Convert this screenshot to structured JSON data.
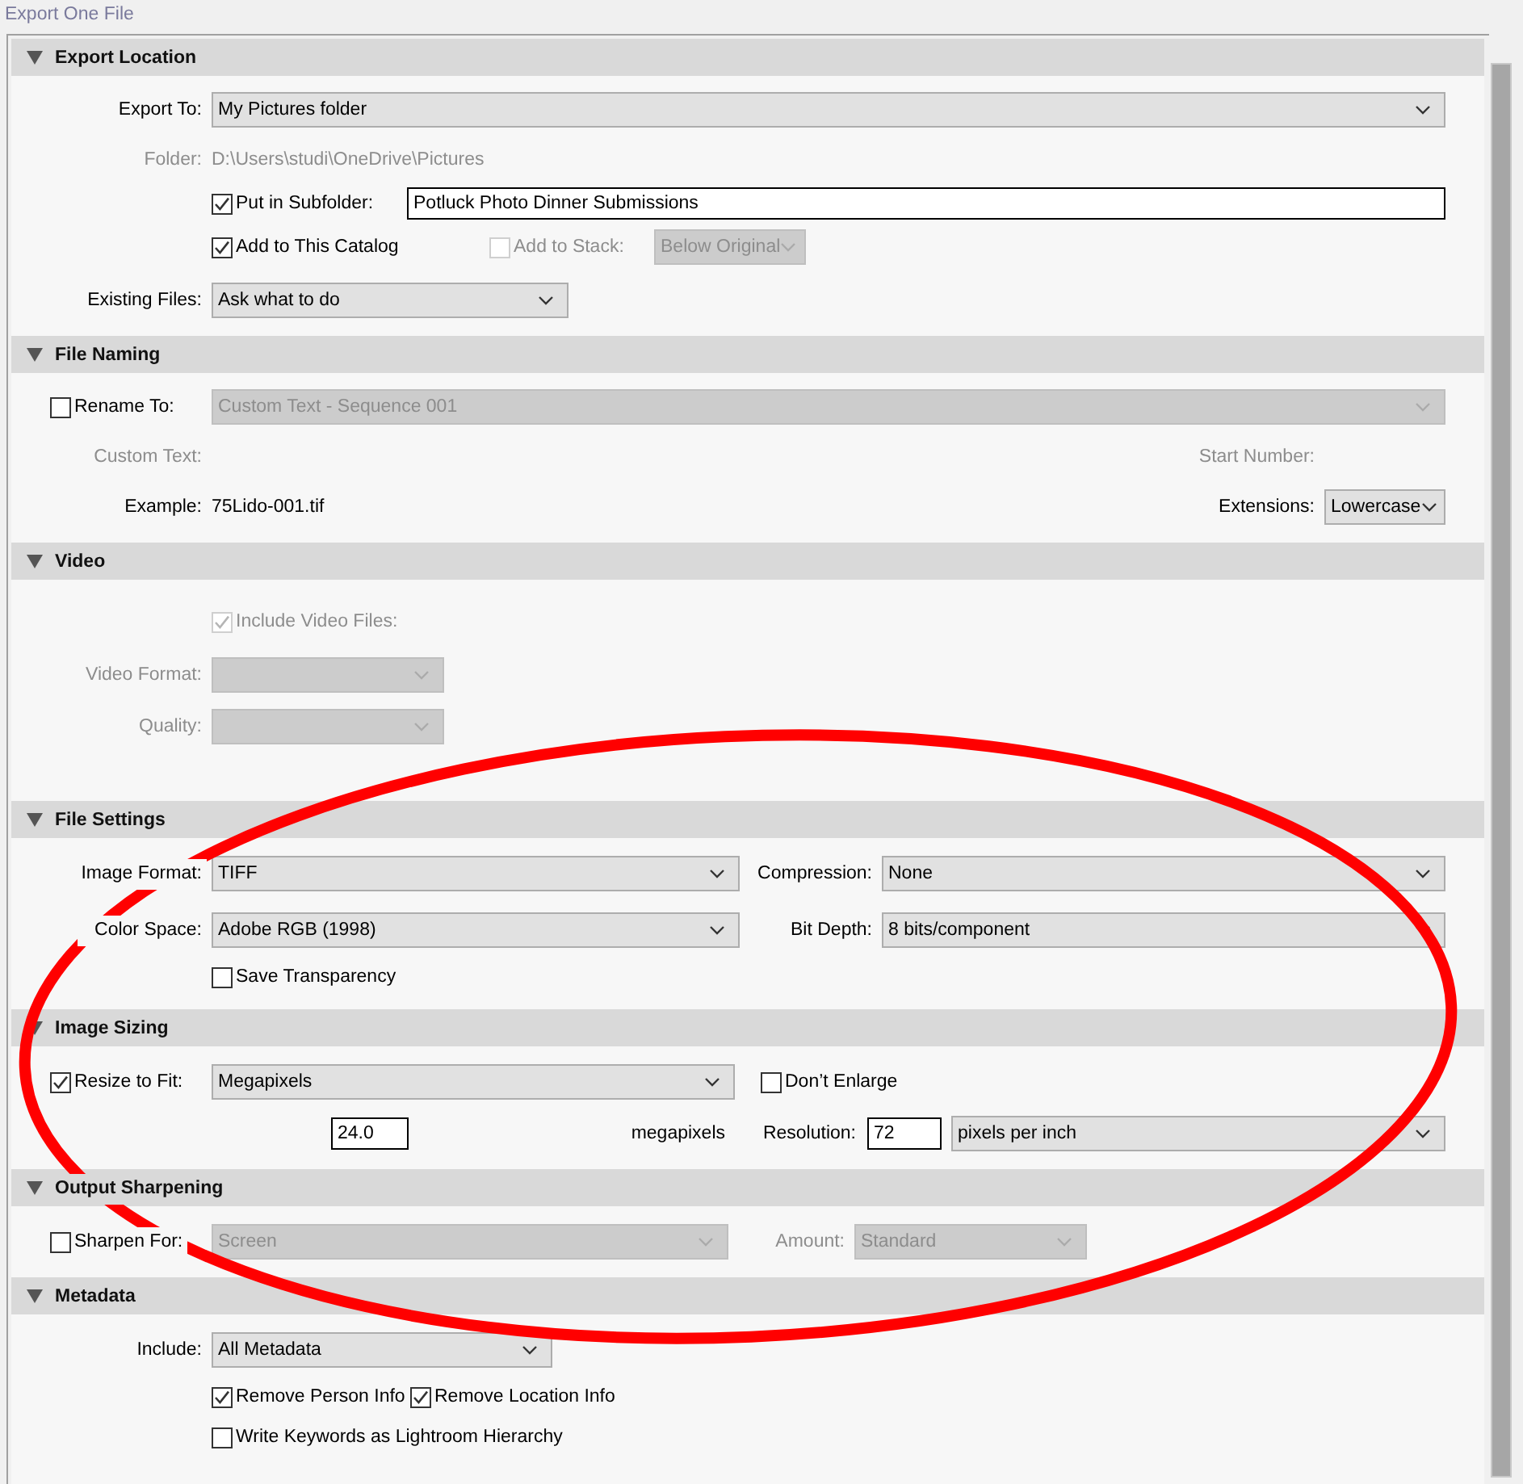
{
  "window": {
    "title": "Export One File"
  },
  "sections": [
    {
      "title": "Export Location",
      "expanded": true,
      "rows": [
        {
          "items": [
            {
              "kind": "label",
              "text": "Export To:",
              "disabled": false
            },
            {
              "kind": "select",
              "value": "My Pictures folder",
              "disabled": false
            }
          ]
        },
        {
          "items": [
            {
              "kind": "label",
              "text": "Folder:",
              "disabled": true
            },
            {
              "kind": "text",
              "text": "D:\\Users\\studi\\OneDrive\\Pictures",
              "disabled": true
            }
          ]
        },
        {
          "items": [
            {
              "kind": "checkbox",
              "label": "Put in Subfolder:",
              "checked": true,
              "disabled": false
            },
            {
              "kind": "input",
              "value": "Potluck Photo Dinner Submissions"
            }
          ]
        },
        {
          "items": [
            {
              "kind": "checkbox",
              "label": "Add to This Catalog",
              "checked": true,
              "disabled": false
            },
            {
              "kind": "checkbox",
              "label": "Add to Stack:",
              "checked": false,
              "disabled": true
            },
            {
              "kind": "select",
              "value": "Below Original",
              "disabled": true
            }
          ]
        },
        {
          "items": [
            {
              "kind": "label",
              "text": "Existing Files:",
              "disabled": false
            },
            {
              "kind": "select",
              "value": "Ask what to do",
              "disabled": false
            }
          ]
        }
      ]
    },
    {
      "title": "File Naming",
      "expanded": true,
      "rows": [
        {
          "items": [
            {
              "kind": "checkbox",
              "label": "Rename To:",
              "checked": false,
              "disabled": false
            },
            {
              "kind": "select",
              "value": "Custom Text - Sequence 001",
              "disabled": true
            }
          ]
        },
        {
          "items": [
            {
              "kind": "label",
              "text": "Custom Text:",
              "disabled": true
            },
            {
              "kind": "label",
              "text": "Start Number:",
              "disabled": true
            }
          ]
        },
        {
          "items": [
            {
              "kind": "label",
              "text": "Example:",
              "disabled": false
            },
            {
              "kind": "text",
              "text": "75Lido-001.tif",
              "disabled": false
            },
            {
              "kind": "label",
              "text": "Extensions:",
              "disabled": false
            },
            {
              "kind": "select",
              "value": "Lowercase",
              "disabled": false
            }
          ]
        }
      ]
    },
    {
      "title": "Video",
      "expanded": true,
      "rows": [
        {
          "items": [
            {
              "kind": "checkbox",
              "label": "Include Video Files:",
              "checked": true,
              "disabled": true
            }
          ]
        },
        {
          "items": [
            {
              "kind": "label",
              "text": "Video Format:",
              "disabled": true
            },
            {
              "kind": "select",
              "disabled": true
            }
          ]
        },
        {
          "items": [
            {
              "kind": "label",
              "text": "Quality:",
              "disabled": true
            },
            {
              "kind": "select",
              "disabled": true
            }
          ]
        }
      ]
    },
    {
      "title": "File Settings",
      "expanded": true,
      "rows": [
        {
          "items": [
            {
              "kind": "label",
              "text": "Image Format:",
              "disabled": false
            },
            {
              "kind": "select",
              "value": "TIFF",
              "disabled": false
            },
            {
              "kind": "label",
              "text": "Compression:",
              "disabled": false
            },
            {
              "kind": "select",
              "value": "None",
              "disabled": false
            }
          ]
        },
        {
          "items": [
            {
              "kind": "label",
              "text": "Color Space:",
              "disabled": false
            },
            {
              "kind": "select",
              "value": "Adobe RGB (1998)",
              "disabled": false
            },
            {
              "kind": "label",
              "text": "Bit Depth:",
              "disabled": false
            },
            {
              "kind": "select",
              "value": "8 bits/component",
              "disabled": false
            }
          ]
        },
        {
          "items": [
            {
              "kind": "checkbox",
              "label": "Save Transparency",
              "checked": false,
              "disabled": false
            }
          ]
        }
      ]
    },
    {
      "title": "Image Sizing",
      "expanded": true,
      "rows": [
        {
          "items": [
            {
              "kind": "checkbox",
              "label": "Resize to Fit:",
              "checked": true,
              "disabled": false
            },
            {
              "kind": "select",
              "value": "Megapixels",
              "disabled": false
            },
            {
              "kind": "checkbox",
              "label": "Don’t Enlarge",
              "checked": false,
              "disabled": false
            }
          ]
        },
        {
          "items": [
            {
              "kind": "input",
              "value": "24.0"
            },
            {
              "kind": "label",
              "text": "megapixels",
              "disabled": false
            },
            {
              "kind": "label",
              "text": "Resolution:",
              "disabled": false
            },
            {
              "kind": "input",
              "value": "72"
            },
            {
              "kind": "select",
              "value": "pixels per inch",
              "disabled": false
            }
          ]
        }
      ]
    },
    {
      "title": "Output Sharpening",
      "expanded": true,
      "rows": [
        {
          "items": [
            {
              "kind": "checkbox",
              "label": "Sharpen For:",
              "checked": false,
              "disabled": false
            },
            {
              "kind": "select",
              "value": "Screen",
              "disabled": true
            },
            {
              "kind": "label",
              "text": "Amount:",
              "disabled": true
            },
            {
              "kind": "select",
              "value": "Standard",
              "disabled": true
            }
          ]
        }
      ]
    },
    {
      "title": "Metadata",
      "expanded": true,
      "rows": [
        {
          "items": [
            {
              "kind": "label",
              "text": "Include:",
              "disabled": false
            },
            {
              "kind": "select",
              "value": "All Metadata",
              "disabled": false
            }
          ]
        },
        {
          "items": [
            {
              "kind": "checkbox",
              "label": "Remove Person Info",
              "checked": true,
              "disabled": false
            },
            {
              "kind": "checkbox",
              "label": "Remove Location Info",
              "checked": true,
              "disabled": false
            }
          ]
        },
        {
          "items": [
            {
              "kind": "checkbox",
              "label": "Write Keywords as Lightroom Hierarchy",
              "checked": false,
              "disabled": false
            }
          ]
        }
      ]
    }
  ],
  "annotation": {
    "kind": "ellipse"
  }
}
